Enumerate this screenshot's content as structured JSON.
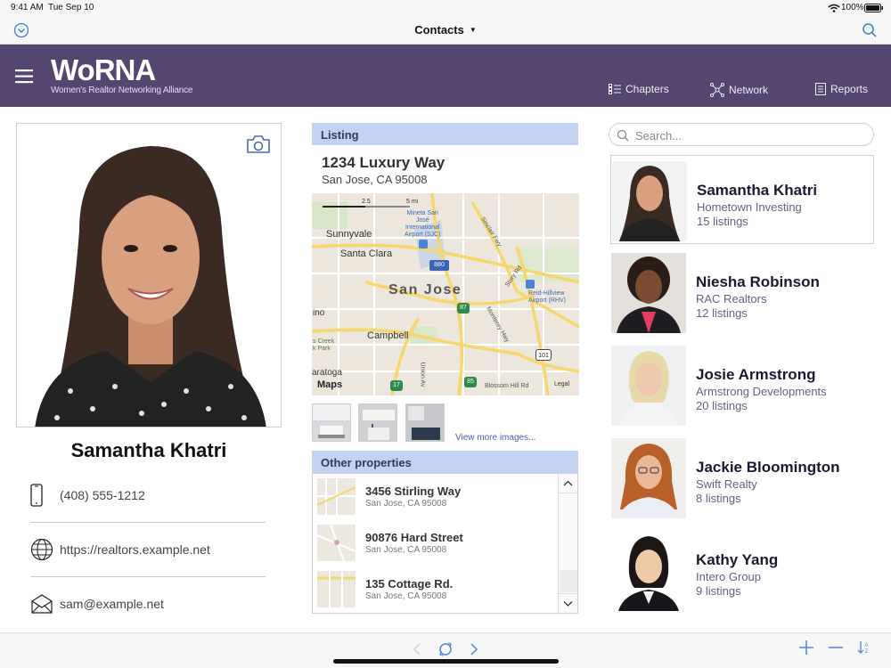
{
  "status": {
    "time": "9:41 AM",
    "date": "Tue Sep 10",
    "battery": "100%"
  },
  "toolbar": {
    "title": "Contacts"
  },
  "header": {
    "logo": "WoRNA",
    "tagline": "Women's Realtor Networking Alliance",
    "nav": [
      {
        "label": "Chapters",
        "icon": "list-icon"
      },
      {
        "label": "Network",
        "icon": "network-icon"
      },
      {
        "label": "Reports",
        "icon": "report-icon"
      }
    ]
  },
  "profile": {
    "name": "Samantha Khatri",
    "phone": "(408) 555-1212",
    "website": "https://realtors.example.net",
    "email": "sam@example.net"
  },
  "listing": {
    "heading": "Listing",
    "address_line1": "1234 Luxury Way",
    "address_line2": "San Jose, CA 95008",
    "map": {
      "city": "San Jose",
      "places": [
        "Sunnyvale",
        "Santa Clara",
        "Campbell",
        "ino",
        "aratoga",
        "s Creek\nk Park",
        "Mineta San\nJosé\nInternational\nAirport (SJC)",
        "Reid-Hillview\nAirport (RHV)",
        "Blossom Hill Rd",
        "Sinclair Fwy",
        "Story Rd",
        "Monterey Hwy",
        "Union Av"
      ],
      "shields": [
        "880",
        "87",
        "101",
        "17",
        "85"
      ],
      "scale": [
        "2.5",
        "5 mi"
      ],
      "attribution": "Maps",
      "legal": "Legal"
    },
    "view_more": "View more images..."
  },
  "other_properties": {
    "heading": "Other properties",
    "items": [
      {
        "name": "3456 Stirling Way",
        "address": "San Jose, CA 95008"
      },
      {
        "name": "90876 Hard Street",
        "address": "San Jose, CA 95008"
      },
      {
        "name": "135 Cottage Rd.",
        "address": "San Jose, CA 95008"
      }
    ]
  },
  "search": {
    "placeholder": "Search..."
  },
  "contacts": [
    {
      "name": "Samantha Khatri",
      "company": "Hometown Investing",
      "listings": "15 listings"
    },
    {
      "name": "Niesha Robinson",
      "company": "RAC Realtors",
      "listings": "12 listings"
    },
    {
      "name": "Josie Armstrong",
      "company": "Armstrong Developments",
      "listings": "20 listings"
    },
    {
      "name": "Jackie Bloomington",
      "company": "Swift Realty",
      "listings": "8 listings"
    },
    {
      "name": "Kathy Yang",
      "company": "Intero Group",
      "listings": "9 listings"
    }
  ],
  "colors": {
    "header": "#54466f",
    "section_head": "#c4d3f4",
    "accent_blue": "#4b88d8",
    "purple_text": "#6a5c82"
  }
}
